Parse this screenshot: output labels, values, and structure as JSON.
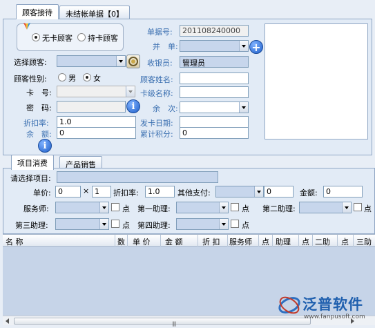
{
  "top_tabs": [
    {
      "label": "顾客接待",
      "active": true
    },
    {
      "label": "未结帐单据【0】",
      "active": false
    }
  ],
  "customer_type": {
    "options": [
      "无卡顾客",
      "持卡顾客"
    ],
    "selected": "无卡顾客"
  },
  "left_form": {
    "select_customer_label": "选择顾客:",
    "gender_label": "顾客性别:",
    "gender_options": [
      "男",
      "女"
    ],
    "gender_selected": "女",
    "card_no_label": "卡　号:",
    "password_label": "密　码:",
    "discount_label": "折扣率:",
    "discount_value": "1.0",
    "balance_label": "余　额:",
    "balance_value": "0"
  },
  "right_form": {
    "doc_no_label": "单据号:",
    "doc_no_value": "201108240000",
    "merge_label": "并　单:",
    "cashier_label": "收银员:",
    "cashier_value": "管理员",
    "customer_name_label": "顾客姓名:",
    "card_level_label": "卡级名称:",
    "remaining_times_label": "余　次:",
    "issue_date_label": "发卡日期:",
    "points_label": "累计积分:",
    "points_value": "0"
  },
  "sub_tabs": [
    {
      "label": "项目消费",
      "active": true
    },
    {
      "label": "产品销售",
      "active": false
    }
  ],
  "item_form": {
    "select_item_label": "请选择项目:",
    "unit_price_label": "单价:",
    "unit_price_value": "0",
    "multiply": "×",
    "qty_value": "1",
    "discount_label": "折扣率:",
    "discount_value": "1.0",
    "other_pay_label": "其他支付:",
    "other_pay_value": "0",
    "amount_label": "金额:",
    "amount_value": "0",
    "stylist_label": "服务师:",
    "assistant1_label": "第一助理:",
    "assistant2_label": "第二助理:",
    "assistant3_label": "第三助理:",
    "assistant4_label": "第四助理:",
    "point_label": "点"
  },
  "grid_columns": [
    "名 称",
    "数",
    "单 价",
    "金 额",
    "折 扣",
    "服务师",
    "点",
    "助理",
    "点",
    "二助",
    "点",
    "三助"
  ],
  "logo": {
    "text": "泛普软件",
    "url_text": "www.fanpusoft.com"
  }
}
